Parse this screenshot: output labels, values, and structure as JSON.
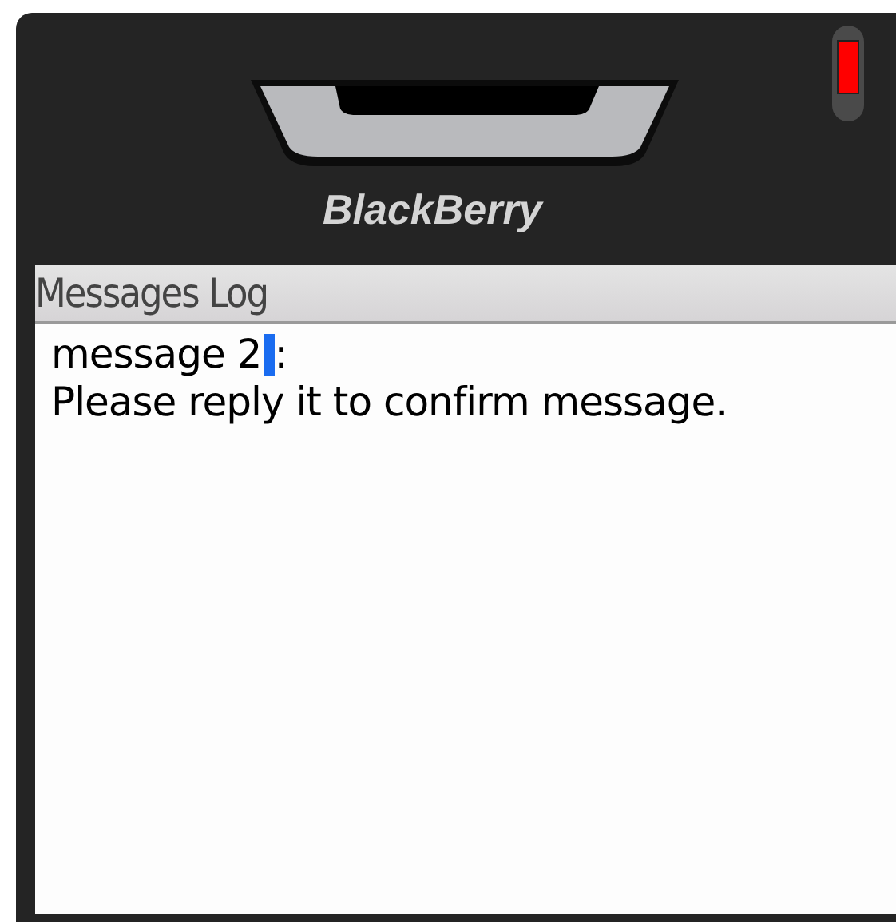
{
  "device": {
    "brand": "BlackBerry",
    "led": {
      "on": true
    }
  },
  "screen": {
    "title": "Messages Log",
    "message": {
      "before_cursor": "message 2",
      "after_cursor": ":",
      "body": "Please reply it to confirm message."
    }
  }
}
